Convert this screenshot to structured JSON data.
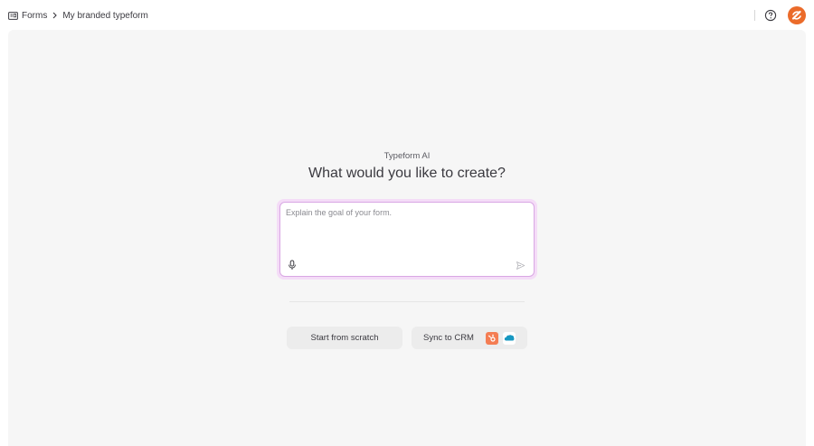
{
  "breadcrumb": {
    "root_label": "Forms",
    "current_label": "My branded typeform"
  },
  "header": {
    "help_icon": "help-circle-icon",
    "avatar_color": "#eb6b2a"
  },
  "main": {
    "eyebrow": "Typeform AI",
    "headline": "What would you like to create?",
    "prompt": {
      "placeholder": "Explain the goal of your form.",
      "value": ""
    },
    "actions": {
      "scratch_label": "Start from scratch",
      "crm_label": "Sync to CRM",
      "crm_logos": [
        "hubspot-logo",
        "salesforce-logo"
      ]
    }
  },
  "colors": {
    "accent_glow": "#f4dcf7",
    "accent_border": "#d9a7e4",
    "canvas_bg": "#f6f6f6",
    "hubspot": "#f47d53",
    "salesforce": "#1798c1"
  }
}
